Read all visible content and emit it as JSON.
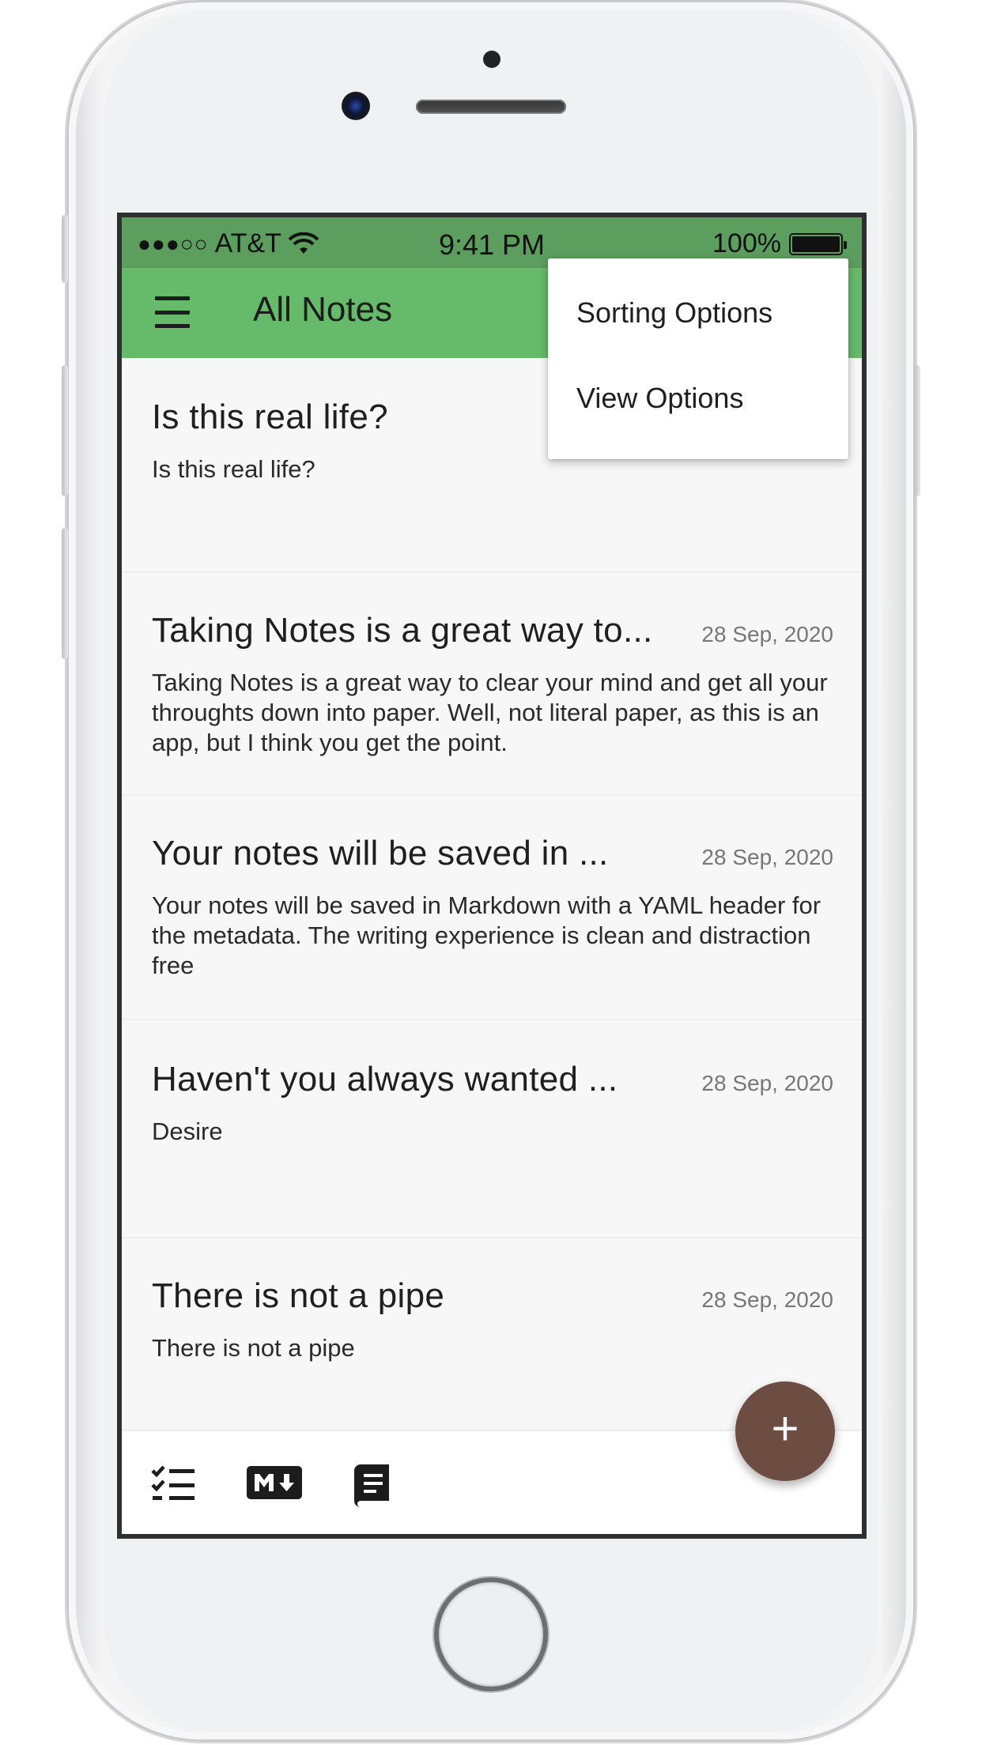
{
  "status_bar": {
    "signal": "●●●○○",
    "carrier": "AT&T",
    "time": "9:41 PM",
    "battery": "100%"
  },
  "app_bar": {
    "title": "All Notes"
  },
  "menu": {
    "items": [
      {
        "label": "Sorting Options"
      },
      {
        "label": "View Options"
      }
    ]
  },
  "notes": [
    {
      "title": "Is this real life?",
      "date": "",
      "body": "Is this real life?"
    },
    {
      "title": "Taking Notes is a great way to...",
      "date": "28 Sep, 2020",
      "body": "Taking Notes is a great way to clear your mind and get all your throughts down into paper. Well, not literal paper, as this is an app, but I think you get the point."
    },
    {
      "title": "Your notes will be saved in ...",
      "date": "28 Sep, 2020",
      "body": "Your notes will be saved in Markdown with a YAML header for the metadata. The writing experience is clean and distraction free"
    },
    {
      "title": "Haven't you always wanted ...",
      "date": "28 Sep, 2020",
      "body": "Desire"
    },
    {
      "title": "There is not a pipe",
      "date": "28 Sep, 2020",
      "body": "There is not a pipe"
    }
  ],
  "bottom_bar": {
    "icons": [
      "checklist-icon",
      "markdown-icon",
      "book-icon"
    ]
  },
  "fab": {
    "label": "+"
  },
  "colors": {
    "app_bar": "#66bb6a",
    "status_bar": "#5b9e5d",
    "fab": "#6d4c41"
  }
}
